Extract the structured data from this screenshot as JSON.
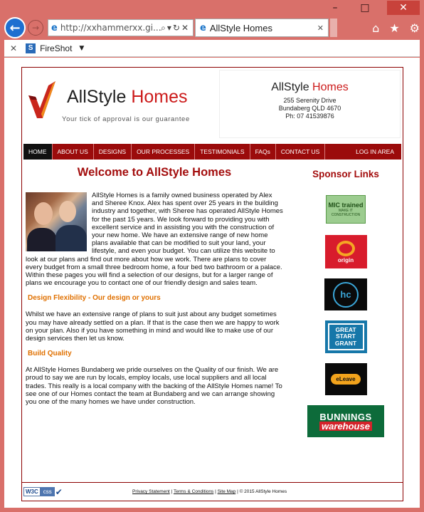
{
  "browser": {
    "address_url": "http://xxhammerxx.gi...",
    "tab_title": "AllStyle Homes",
    "tab_close": "✕",
    "fireshot_label": "FireShot",
    "fireshot_icon": "S",
    "cmd_close": "✕",
    "cmd_caret": "▼",
    "back_glyph": "←",
    "forward_glyph": "→",
    "home_glyph": "⌂",
    "fav_glyph": "★",
    "settings_glyph": "⚙",
    "addr_buttons": "⌕▾↻✕",
    "ie_glyph": "e",
    "min_glyph": "–",
    "max_glyph": "□",
    "close_glyph": "✕"
  },
  "site": {
    "logo": {
      "brand_a": "AllStyle ",
      "brand_b": "Homes",
      "tagline": "Your tick of approval is our guarantee"
    },
    "contact": {
      "name_a": "AllStyle ",
      "name_b": "Homes",
      "street": "255 Serenity Drive",
      "city": "Bundaberg QLD 4670",
      "phone": "Ph: 07 41539876"
    },
    "nav": [
      "HOME",
      "ABOUT US",
      "DESIGNS",
      "OUR PROCESSES",
      "TESTIMONIALS",
      "FAQs",
      "CONTACT US"
    ],
    "nav_login": "LOG IN AREA",
    "main": {
      "title": "Welcome to AllStyle Homes",
      "intro": "AllStyle Homes is a family owned business operated by Alex and Sheree Knox. Alex has spent over 25 years in the building industry and together, with Sheree has operated AllStyle Homes for the past 15 years. We look forward to providing you with excellent service and in assisting you with the construction of your new home. We have an extensive range of new home plans available that can be modified to suit your land, your lifestyle, and even your budget. You can utilize this website to look at our plans and find out more about how we work. There are plans to cover every budget from a small three bedroom home, a four bed two bathroom or a palace. Within these pages you will find a selection of our designs, but for a larger range of plans we encourage you to contact one of our friendly design and sales team.",
      "h_design": "Design Flexibility - Our design or yours",
      "p_design": "Whilst we have an extensive range of plans to suit just about any budget sometimes you may have already settled on a plan. If that is the case then we are happy to work on your plan. Also if you have something in mind and would like to make use of our design services then let us know.",
      "h_quality": "Build Quality",
      "p_quality": "At AllStyle Homes Bundaberg we pride ourselves on the Quality of our finish. We are proud to say we are run by locals, employ locals, use local suppliers and all local trades. This really is a local company with the backing of the AllStyle Homes name! To see one of our Homes contact the team at Bundaberg and we can arrange showing you one of the many homes we have under construction."
    },
    "sponsors": {
      "title": "Sponsor Links",
      "mic": "MIC trained",
      "mic_sub": "MAKE IT CONSTRUCTION",
      "origin": "origin",
      "hc": "hc",
      "great": "GREAT START GRANT",
      "leave": "eLeave",
      "bunnings_1": "BUNNINGS",
      "bunnings_2": "warehouse"
    },
    "footer": {
      "w3c": "W3C",
      "css": "css",
      "check": "✔",
      "privacy": "Privacy Statement",
      "terms": "Terms & Conditions",
      "sitemap": "Site Map",
      "sep": " | ",
      "copyright": " | © 2015 AllStyle Homes"
    }
  },
  "colors": {
    "frame": "#d9706a",
    "brand_red": "#a30d0d",
    "nav_bg": "#9b0b0b",
    "heading_orange": "#e07000"
  }
}
